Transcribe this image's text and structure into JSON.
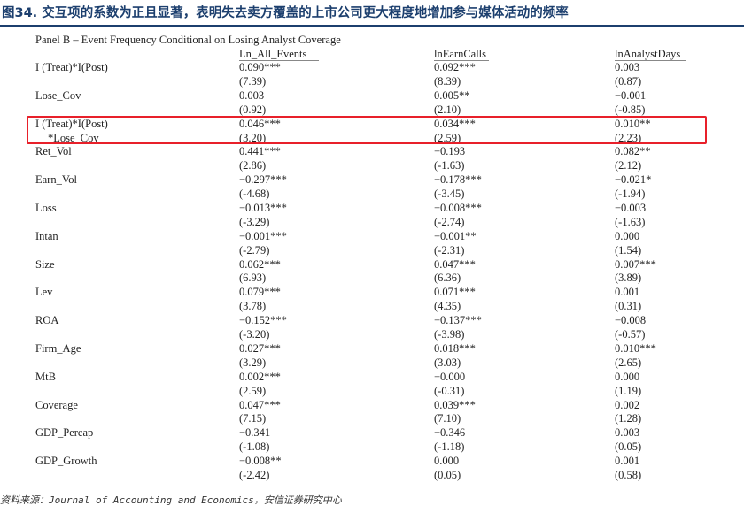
{
  "figure": {
    "title": "图34. 交互项的系数为正且显著，表明失去卖方覆盖的上市公司更大程度地增加参与媒体活动的频率",
    "source": "资料来源：Journal of Accounting and Economics，安信证券研究中心",
    "highlight_color": "#e8202a",
    "title_color": "#1c3f6e"
  },
  "table": {
    "panel_title": "Panel B – Event Frequency Conditional on Losing Analyst Coverage",
    "columns": [
      "Ln_All_Events",
      "lnEarnCalls",
      "lnAnalystDays"
    ],
    "rows": [
      {
        "var": [
          "I (Treat)*I(Post)"
        ],
        "v1": [
          "0.090***",
          "(7.39)"
        ],
        "v2": [
          "0.092***",
          "(8.39)"
        ],
        "v3": [
          "0.003",
          "(0.87)"
        ]
      },
      {
        "var": [
          "Lose_Cov"
        ],
        "v1": [
          "0.003",
          "(0.92)"
        ],
        "v2": [
          "0.005**",
          "(2.10)"
        ],
        "v3": [
          "−0.001",
          "(-0.85)"
        ]
      },
      {
        "var": [
          "I (Treat)*I(Post)",
          "*Lose_Cov"
        ],
        "v1": [
          "0.046***",
          "(3.20)"
        ],
        "v2": [
          "0.034***",
          "(2.59)"
        ],
        "v3": [
          "0.010**",
          "(2.23)"
        ],
        "highlighted": true
      },
      {
        "var": [
          "Ret_Vol"
        ],
        "v1": [
          "0.441***",
          "(2.86)"
        ],
        "v2": [
          "−0.193",
          "(-1.63)"
        ],
        "v3": [
          "0.082**",
          "(2.12)"
        ]
      },
      {
        "var": [
          "Earn_Vol"
        ],
        "v1": [
          "−0.297***",
          "(-4.68)"
        ],
        "v2": [
          "−0.178***",
          "(-3.45)"
        ],
        "v3": [
          "−0.021*",
          "(-1.94)"
        ]
      },
      {
        "var": [
          "Loss"
        ],
        "v1": [
          "−0.013***",
          "(-3.29)"
        ],
        "v2": [
          "−0.008***",
          "(-2.74)"
        ],
        "v3": [
          "−0.003",
          "(-1.63)"
        ]
      },
      {
        "var": [
          "Intan"
        ],
        "v1": [
          "−0.001***",
          "(-2.79)"
        ],
        "v2": [
          "−0.001**",
          "(-2.31)"
        ],
        "v3": [
          "0.000",
          "(1.54)"
        ]
      },
      {
        "var": [
          "Size"
        ],
        "v1": [
          "0.062***",
          "(6.93)"
        ],
        "v2": [
          "0.047***",
          "(6.36)"
        ],
        "v3": [
          "0.007***",
          "(3.89)"
        ]
      },
      {
        "var": [
          "Lev"
        ],
        "v1": [
          "0.079***",
          "(3.78)"
        ],
        "v2": [
          "0.071***",
          "(4.35)"
        ],
        "v3": [
          "0.001",
          "(0.31)"
        ]
      },
      {
        "var": [
          "ROA"
        ],
        "v1": [
          "−0.152***",
          "(-3.20)"
        ],
        "v2": [
          "−0.137***",
          "(-3.98)"
        ],
        "v3": [
          "−0.008",
          "(-0.57)"
        ]
      },
      {
        "var": [
          "Firm_Age"
        ],
        "v1": [
          "0.027***",
          "(3.29)"
        ],
        "v2": [
          "0.018***",
          "(3.03)"
        ],
        "v3": [
          "0.010***",
          "(2.65)"
        ]
      },
      {
        "var": [
          "MtB"
        ],
        "v1": [
          "0.002***",
          "(2.59)"
        ],
        "v2": [
          "−0.000",
          "(-0.31)"
        ],
        "v3": [
          "0.000",
          "(1.19)"
        ]
      },
      {
        "var": [
          "Coverage"
        ],
        "v1": [
          "0.047***",
          "(7.15)"
        ],
        "v2": [
          "0.039***",
          "(7.10)"
        ],
        "v3": [
          "0.002",
          "(1.28)"
        ]
      },
      {
        "var": [
          "GDP_Percap"
        ],
        "v1": [
          "−0.341",
          "(-1.08)"
        ],
        "v2": [
          "−0.346",
          "(-1.18)"
        ],
        "v3": [
          "0.003",
          "(0.05)"
        ]
      },
      {
        "var": [
          "GDP_Growth"
        ],
        "v1": [
          "−0.008**",
          "(-2.42)"
        ],
        "v2": [
          "0.000",
          "(0.05)"
        ],
        "v3": [
          "0.001",
          "(0.58)"
        ]
      }
    ]
  }
}
